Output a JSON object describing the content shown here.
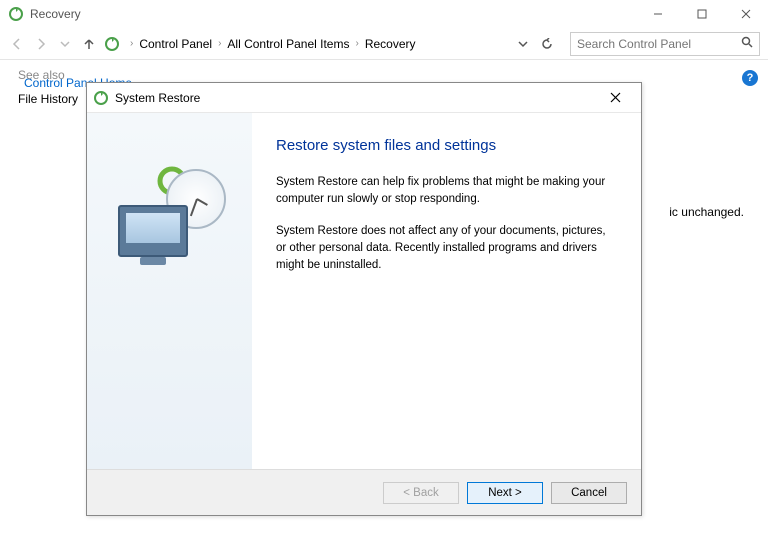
{
  "window": {
    "title": "Recovery"
  },
  "breadcrumb": {
    "items": [
      "Control Panel",
      "All Control Panel Items",
      "Recovery"
    ]
  },
  "search": {
    "placeholder": "Search Control Panel"
  },
  "sidebar": {
    "home_link": "Control Panel Home",
    "see_also_label": "See also",
    "file_history_link": "File History"
  },
  "background": {
    "partial_text": "ic unchanged."
  },
  "help": {
    "glyph": "?"
  },
  "modal": {
    "title": "System Restore",
    "heading": "Restore system files and settings",
    "para1": "System Restore can help fix problems that might be making your computer run slowly or stop responding.",
    "para2": "System Restore does not affect any of your documents, pictures, or other personal data. Recently installed programs and drivers might be uninstalled.",
    "buttons": {
      "back": "< Back",
      "next": "Next >",
      "cancel": "Cancel"
    }
  }
}
